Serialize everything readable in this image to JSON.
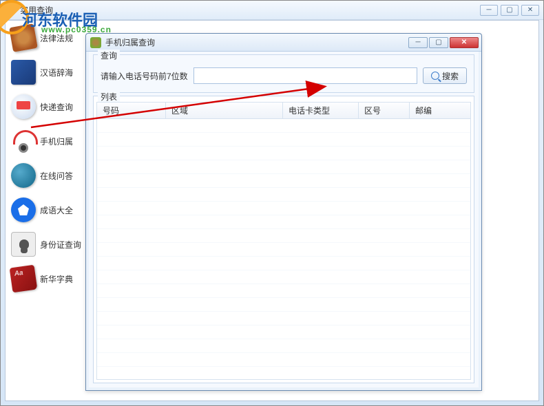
{
  "outer": {
    "title": "实用查询"
  },
  "watermark": {
    "brand": "河东软件园",
    "url": "www.pc0359.cn"
  },
  "sidebar": {
    "items": [
      {
        "label": "法律法规"
      },
      {
        "label": "汉语辞海"
      },
      {
        "label": "快递查询"
      },
      {
        "label": "手机归属"
      },
      {
        "label": "在线问答"
      },
      {
        "label": "成语大全"
      },
      {
        "label": "身份证查询"
      },
      {
        "label": "新华字典"
      }
    ]
  },
  "inner": {
    "title": "手机归属查询",
    "query": {
      "legend": "查询",
      "label": "请输入电话号码前7位数",
      "value": "",
      "search_btn": "搜索"
    },
    "list": {
      "legend": "列表",
      "columns": [
        "号码",
        "区域",
        "电话卡类型",
        "区号",
        "邮编"
      ],
      "rows": []
    }
  }
}
